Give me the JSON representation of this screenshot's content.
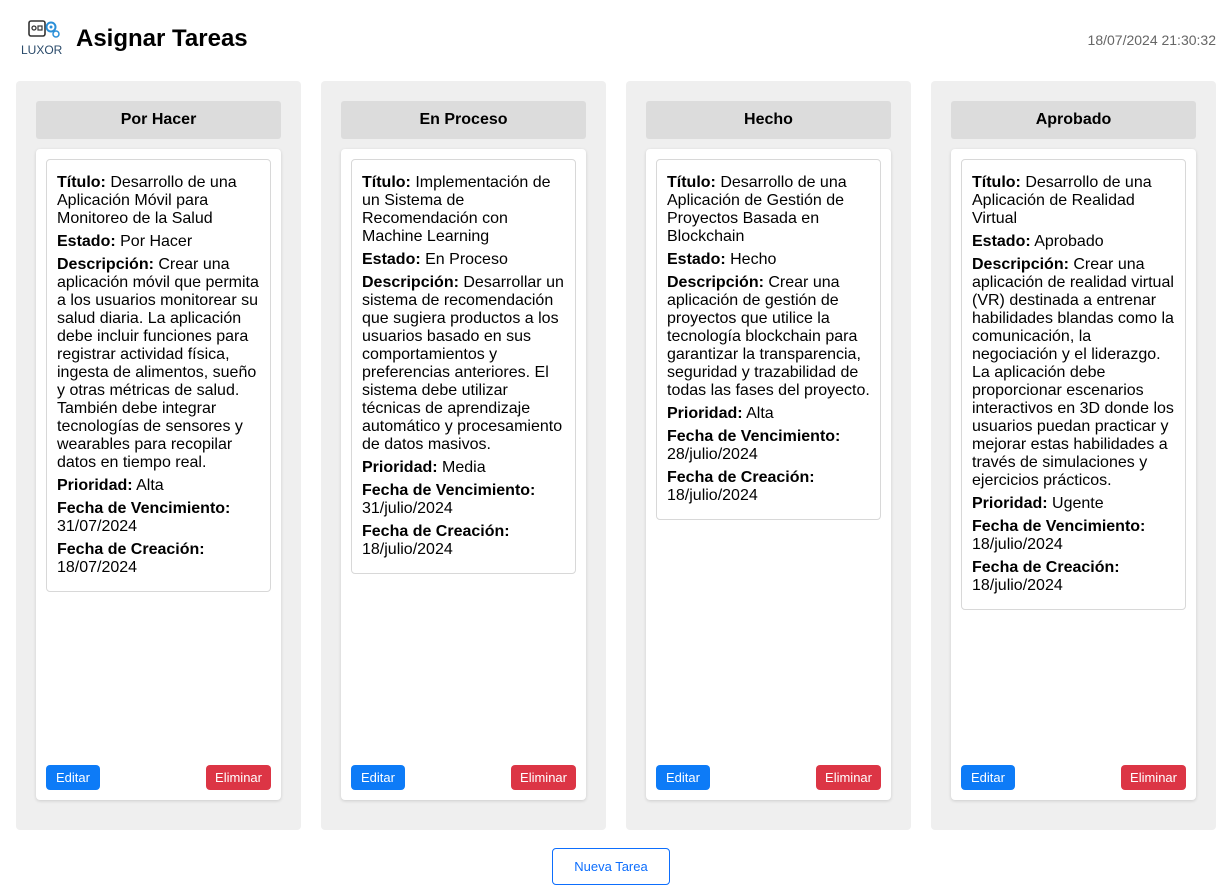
{
  "header": {
    "logo_text": "LUXOR",
    "title": "Asignar Tareas",
    "datetime": "18/07/2024 21:30:32"
  },
  "labels": {
    "titulo": "Título:",
    "estado": "Estado:",
    "descripcion": "Descripción:",
    "prioridad": "Prioridad:",
    "vencimiento": "Fecha de Vencimiento:",
    "creacion": "Fecha de Creación:"
  },
  "buttons": {
    "edit": "Editar",
    "delete": "Eliminar",
    "new_task": "Nueva Tarea"
  },
  "colors": {
    "edit": "#0d7bf7",
    "delete": "#dc3545",
    "column_bg": "#efefef",
    "column_header_bg": "#dcdcdc"
  },
  "columns": [
    {
      "title": "Por Hacer",
      "task": {
        "titulo": "Desarrollo de una Aplicación Móvil para Monitoreo de la Salud",
        "estado": "Por Hacer",
        "descripcion": "Crear una aplicación móvil que permita a los usuarios monitorear su salud diaria. La aplicación debe incluir funciones para registrar actividad física, ingesta de alimentos, sueño y otras métricas de salud. También debe integrar tecnologías de sensores y wearables para recopilar datos en tiempo real.",
        "prioridad": "Alta",
        "vencimiento": "31/07/2024",
        "creacion": "18/07/2024"
      }
    },
    {
      "title": "En Proceso",
      "task": {
        "titulo": "Implementación de un Sistema de Recomendación con Machine Learning",
        "estado": "En Proceso",
        "descripcion": "Desarrollar un sistema de recomendación que sugiera productos a los usuarios basado en sus comportamientos y preferencias anteriores. El sistema debe utilizar técnicas de aprendizaje automático y procesamiento de datos masivos.",
        "prioridad": "Media",
        "vencimiento": "31/julio/2024",
        "creacion": "18/julio/2024"
      }
    },
    {
      "title": "Hecho",
      "task": {
        "titulo": "Desarrollo de una Aplicación de Gestión de Proyectos Basada en Blockchain",
        "estado": "Hecho",
        "descripcion": "Crear una aplicación de gestión de proyectos que utilice la tecnología blockchain para garantizar la transparencia, seguridad y trazabilidad de todas las fases del proyecto.",
        "prioridad": "Alta",
        "vencimiento": "28/julio/2024",
        "creacion": "18/julio/2024"
      }
    },
    {
      "title": "Aprobado",
      "task": {
        "titulo": "Desarrollo de una Aplicación de Realidad Virtual",
        "estado": "Aprobado",
        "descripcion": "Crear una aplicación de realidad virtual (VR) destinada a entrenar habilidades blandas como la comunicación, la negociación y el liderazgo. La aplicación debe proporcionar escenarios interactivos en 3D donde los usuarios puedan practicar y mejorar estas habilidades a través de simulaciones y ejercicios prácticos.",
        "prioridad": "Ugente",
        "vencimiento": "18/julio/2024",
        "creacion": "18/julio/2024"
      }
    }
  ]
}
